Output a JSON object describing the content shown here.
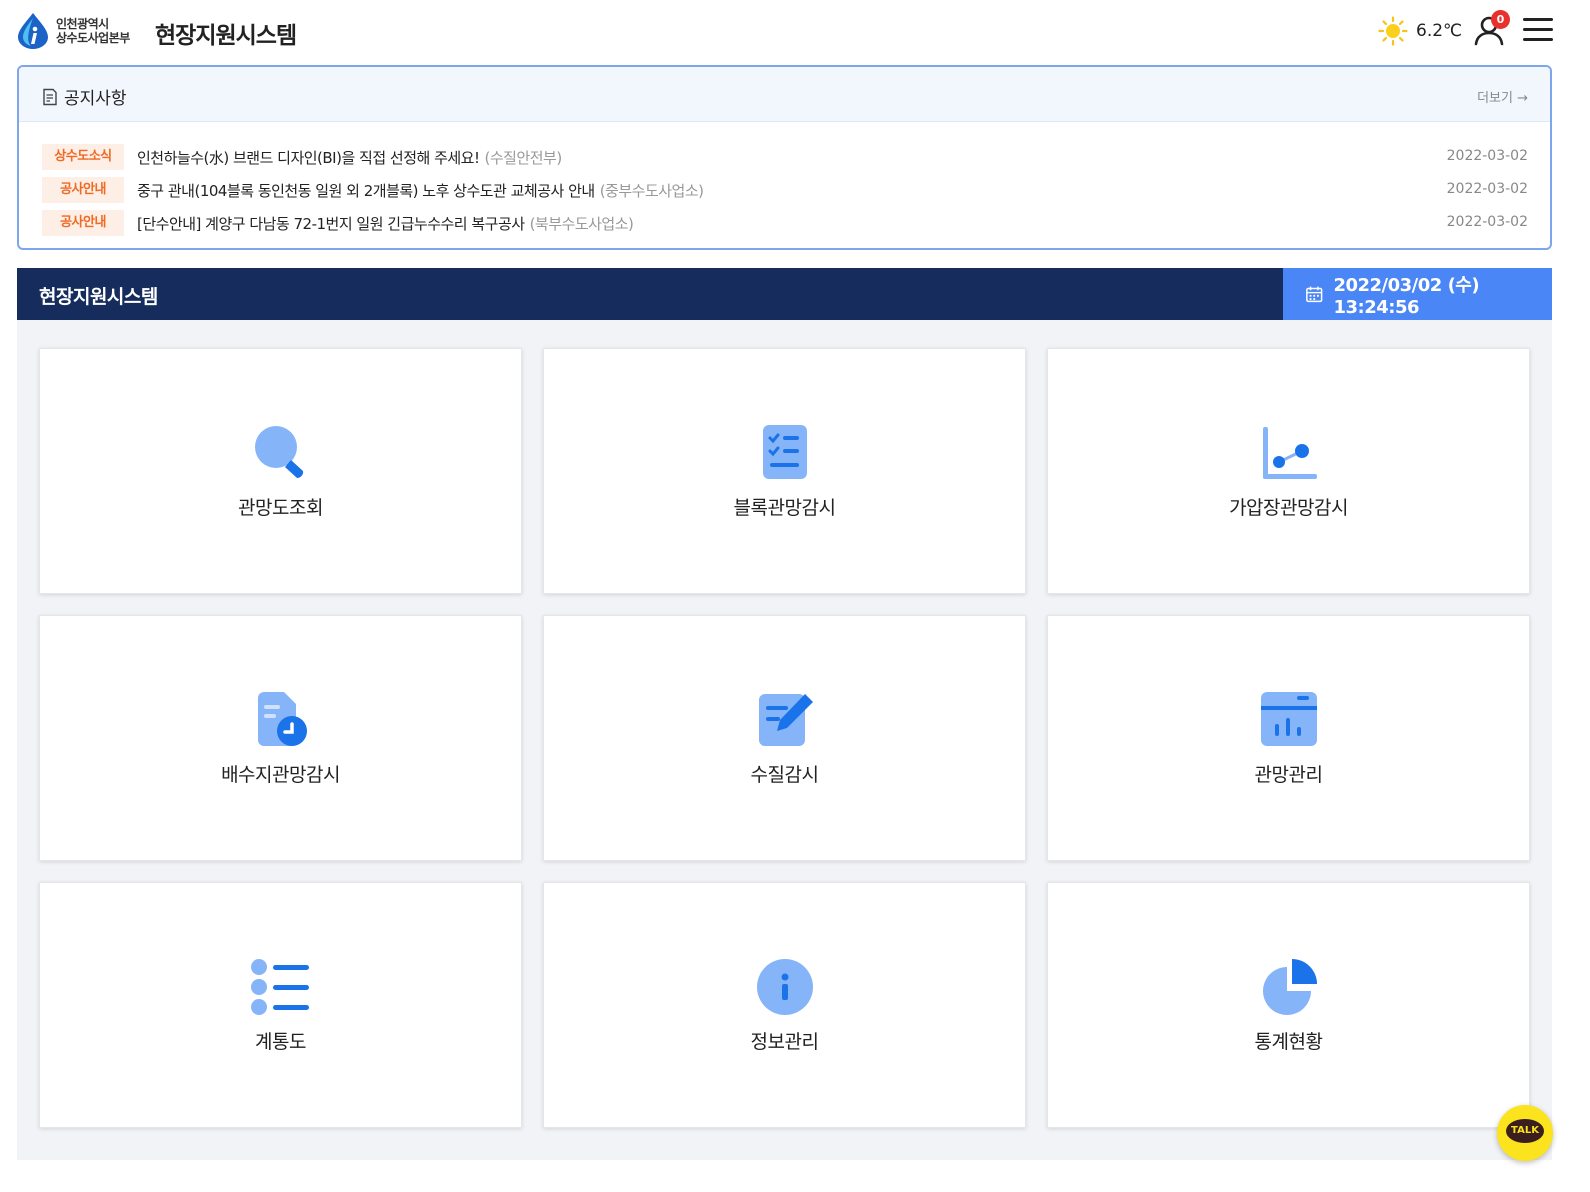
{
  "header": {
    "logo_line1": "인천광역시",
    "logo_line2": "상수도사업본부",
    "title": "현장지원시스템",
    "weather_icon": "sun-icon",
    "temperature": "6.2℃",
    "notification_count": "0"
  },
  "notice": {
    "title": "공지사항",
    "more": "더보기 →",
    "items": [
      {
        "category": "상수도소식",
        "text": "인천하늘수(水) 브랜드 디자인(BI)을 직접 선정해 주세요!",
        "dept": "(수질안전부)",
        "date": "2022-03-02"
      },
      {
        "category": "공사안내",
        "text": "중구 관내(104블록 동인천동 일원 외 2개블록) 노후 상수도관 교체공사 안내",
        "dept": "(중부수도사업소)",
        "date": "2022-03-02"
      },
      {
        "category": "공사안내",
        "text": "[단수안내] 계양구 다남동 72-1번지 일원 긴급누수수리 복구공사",
        "dept": "(북부수도사업소)",
        "date": "2022-03-02"
      }
    ]
  },
  "section": {
    "title": "현장지원시스템",
    "datetime": "2022/03/02 (수) 13:24:56"
  },
  "menu": [
    {
      "label": "관망도조회",
      "icon": "search-icon"
    },
    {
      "label": "블록관망감시",
      "icon": "checklist-icon"
    },
    {
      "label": "가압장관망감시",
      "icon": "chart-icon"
    },
    {
      "label": "배수지관망감시",
      "icon": "document-clock-icon"
    },
    {
      "label": "수질감시",
      "icon": "edit-icon"
    },
    {
      "label": "관망관리",
      "icon": "calendar-chart-icon"
    },
    {
      "label": "계통도",
      "icon": "list-icon"
    },
    {
      "label": "정보관리",
      "icon": "info-icon"
    },
    {
      "label": "통계현황",
      "icon": "pie-chart-icon"
    }
  ],
  "chat": {
    "label": "TALK"
  },
  "colors": {
    "navy": "#152c5c",
    "accent_blue": "#4a86f5",
    "icon_light": "#85b5f8",
    "icon_dark": "#1a73e8",
    "badge_orange": "#f06a23"
  }
}
